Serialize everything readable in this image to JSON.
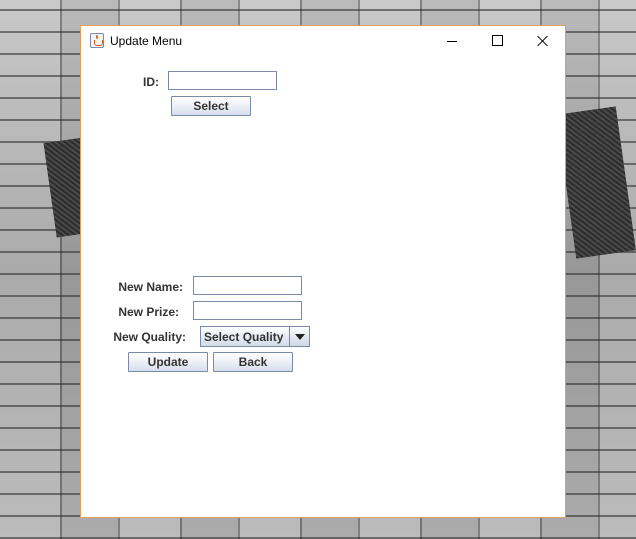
{
  "window": {
    "title": "Update Menu",
    "icon": "java-cup-icon",
    "controls": [
      "minimize-icon",
      "maximize-icon",
      "close-icon"
    ]
  },
  "select_section": {
    "id_label": "ID:",
    "id_value": "",
    "select_button": "Select"
  },
  "update_section": {
    "name_label": "New Name:",
    "name_value": "",
    "prize_label": "New Prize:",
    "prize_value": "",
    "quality_label": "New Quality:",
    "quality_selected": "Select Quality",
    "update_button": "Update",
    "back_button": "Back"
  }
}
